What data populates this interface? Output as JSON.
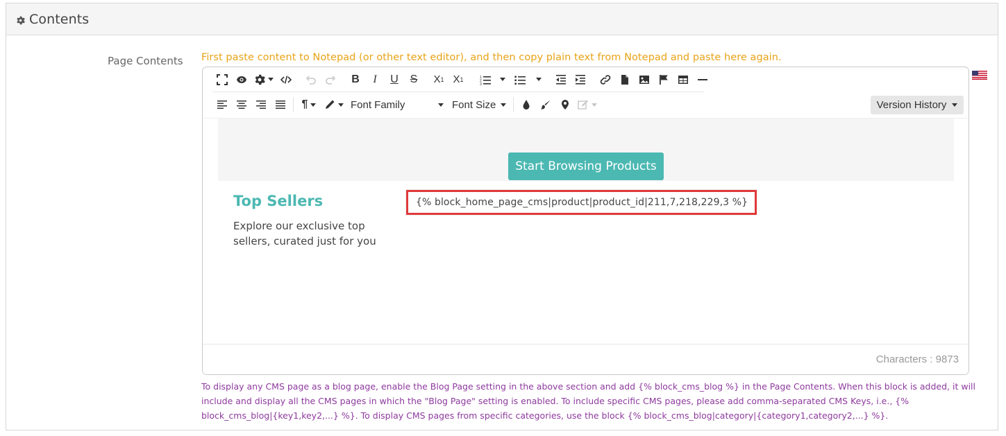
{
  "section": {
    "title": "Contents"
  },
  "field": {
    "label": "Page Contents",
    "paste_note": "First paste content to Notepad (or other text editor), and then copy plain text from Notepad and paste here again."
  },
  "toolbar": {
    "row1": [
      "fullscreen-icon",
      "eye-icon",
      "gear-icon",
      "code-view-icon",
      "undo-icon",
      "redo-icon",
      "bold-icon",
      "italic-icon",
      "underline-icon",
      "strikethrough-icon",
      "subscript-icon",
      "superscript-icon",
      "ordered-list-icon",
      "unordered-list-icon",
      "outdent-icon",
      "indent-icon",
      "link-icon",
      "file-icon",
      "image-icon",
      "flag-icon",
      "table-icon",
      "horizontal-line-icon"
    ],
    "font_family_label": "Font Family",
    "font_size_label": "Font Size",
    "version_history_label": "Version History"
  },
  "content": {
    "button_label": "Start Browsing Products",
    "top_sellers_title": "Top Sellers",
    "top_sellers_desc": "Explore our exclusive top sellers, curated just for you",
    "code_block": "{% block_home_page_cms|product|product_id|211,7,218,229,3 %}"
  },
  "status": {
    "characters": "Characters : 9873"
  },
  "help": {
    "text": "To display any CMS page as a blog page, enable the Blog Page setting in the above section and add {% block_cms_blog %} in the Page Contents. When this block is added, it will include and display all the CMS pages in which the \"Blog Page\" setting is enabled. To include specific CMS pages, please add comma-separated CMS Keys, i.e., {% block_cms_blog|{key1,key2,...} %}. To display CMS pages from specific categories, use the block {% block_cms_blog|category|{category1,category2,...} %}."
  },
  "colors": {
    "accent": "#4cb8b2",
    "note": "#e8a317",
    "help": "#8e3a9e",
    "highlight": "#e0393a"
  }
}
